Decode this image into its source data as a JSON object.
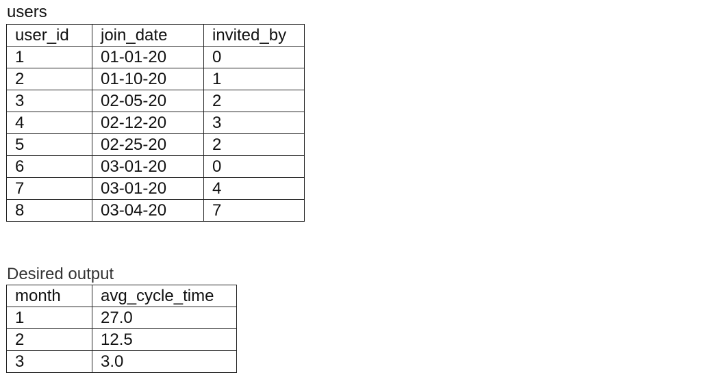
{
  "users": {
    "caption": "users",
    "columns": [
      "user_id",
      "join_date",
      "invited_by"
    ],
    "rows": [
      [
        "1",
        "01-01-20",
        "0"
      ],
      [
        "2",
        "01-10-20",
        "1"
      ],
      [
        "3",
        "02-05-20",
        "2"
      ],
      [
        "4",
        "02-12-20",
        "3"
      ],
      [
        "5",
        "02-25-20",
        "2"
      ],
      [
        "6",
        "03-01-20",
        "0"
      ],
      [
        "7",
        "03-01-20",
        "4"
      ],
      [
        "8",
        "03-04-20",
        "7"
      ]
    ]
  },
  "output": {
    "caption": "Desired output",
    "columns": [
      "month",
      "avg_cycle_time"
    ],
    "rows": [
      [
        "1",
        "27.0"
      ],
      [
        "2",
        "12.5"
      ],
      [
        "3",
        "3.0"
      ]
    ]
  }
}
